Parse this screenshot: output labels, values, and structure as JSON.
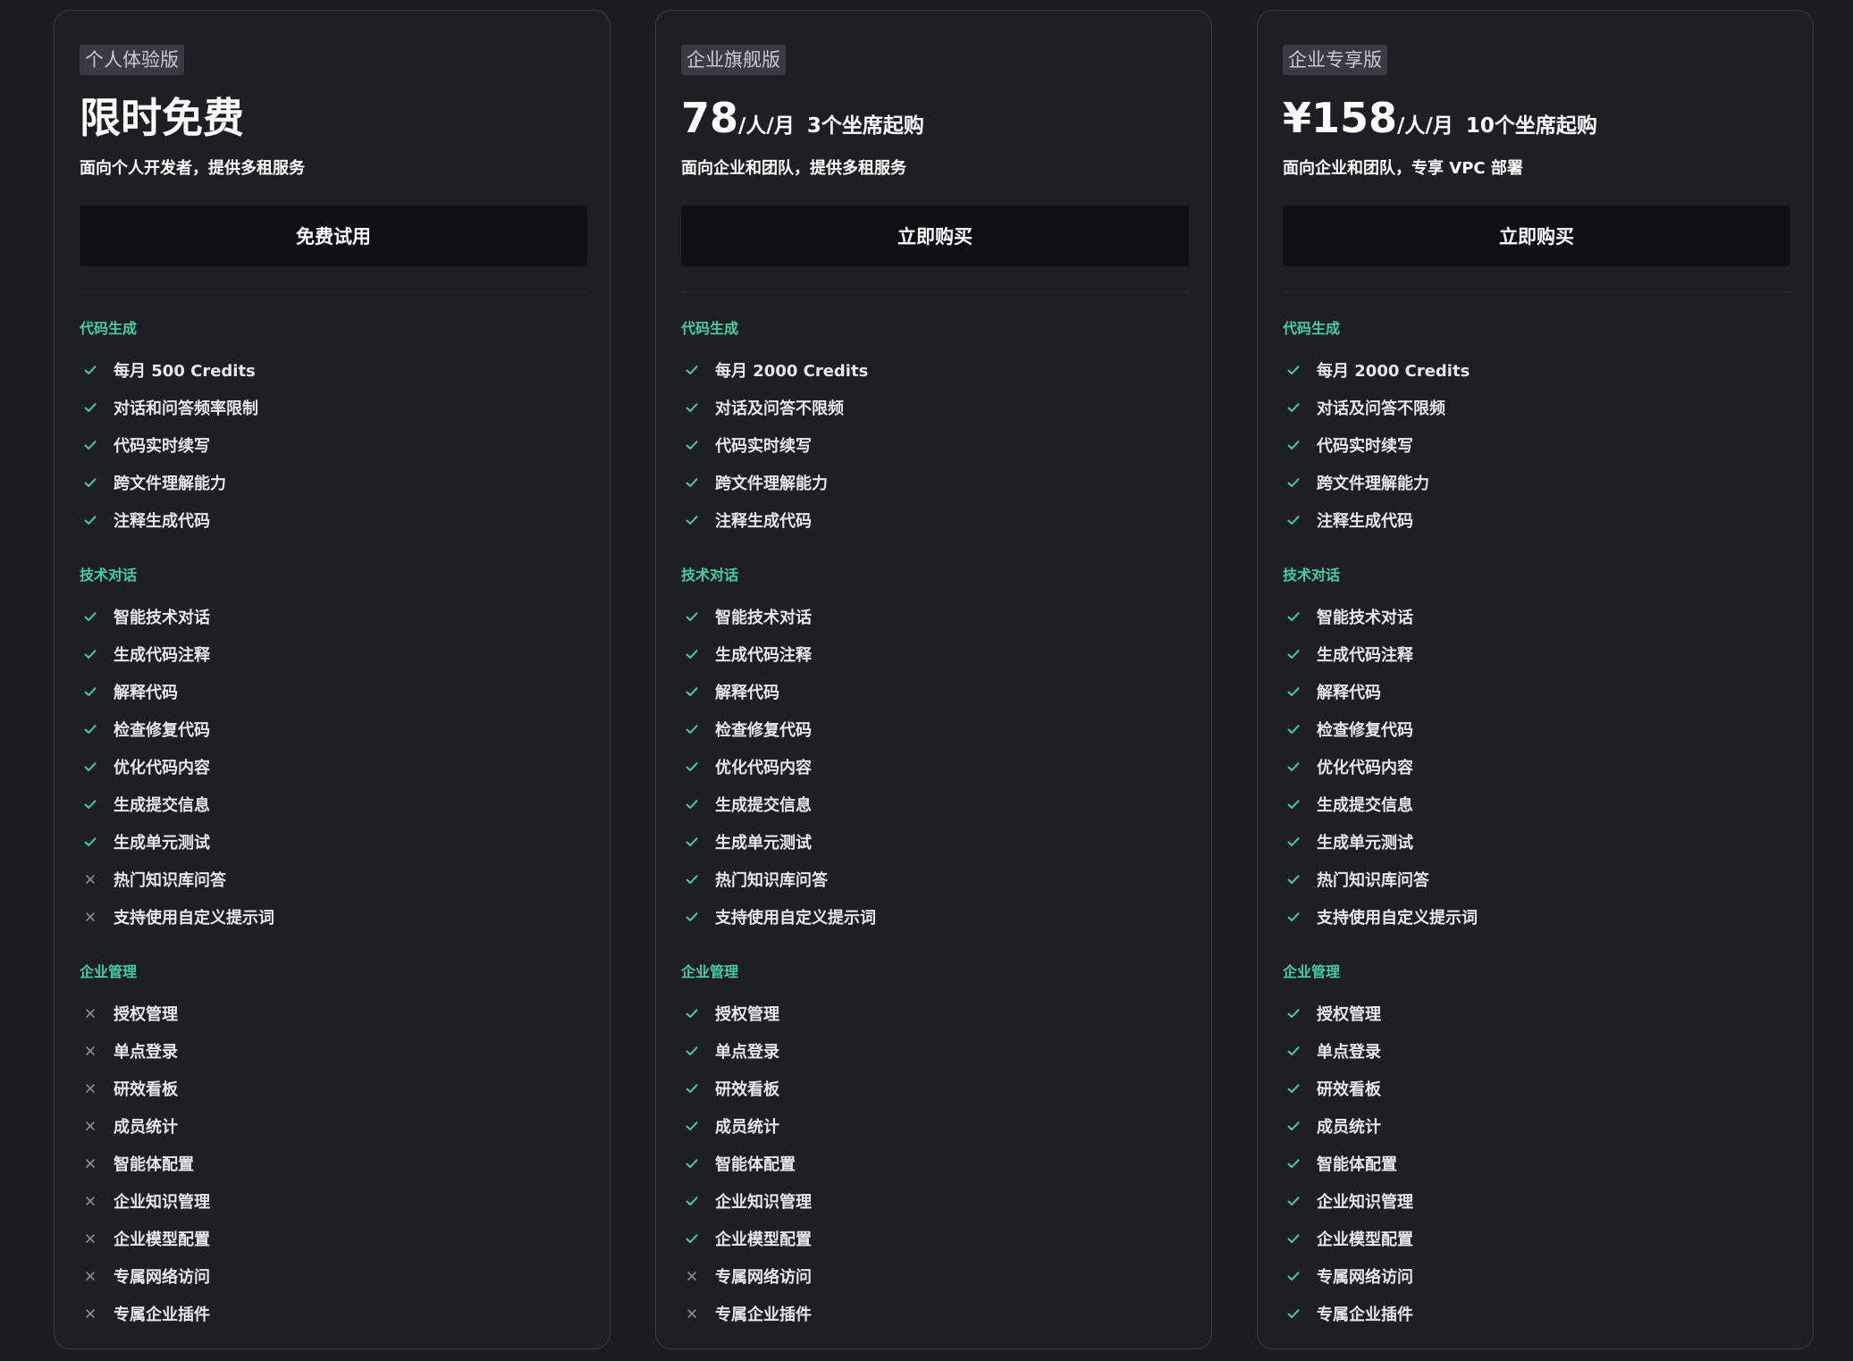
{
  "colors": {
    "background": "#1c1c22",
    "card": "#1e1e25",
    "card_border": "#3a3a44",
    "accent_green": "#3fd1a0",
    "cross_gray": "#8a8a96",
    "button_bg": "#0f0f14"
  },
  "plans": [
    {
      "badge": "个人体验版",
      "price": "限时免费",
      "unit": "",
      "note": "",
      "description": "面向个人开发者，提供多租服务",
      "cta": "免费试用",
      "sections": [
        {
          "title": "代码生成",
          "items": [
            {
              "label": "每月 500 Credits",
              "included": true
            },
            {
              "label": "对话和问答频率限制",
              "included": true
            },
            {
              "label": "代码实时续写",
              "included": true
            },
            {
              "label": "跨文件理解能力",
              "included": true
            },
            {
              "label": "注释生成代码",
              "included": true
            }
          ]
        },
        {
          "title": "技术对话",
          "items": [
            {
              "label": "智能技术对话",
              "included": true
            },
            {
              "label": "生成代码注释",
              "included": true
            },
            {
              "label": "解释代码",
              "included": true
            },
            {
              "label": "检查修复代码",
              "included": true
            },
            {
              "label": "优化代码内容",
              "included": true
            },
            {
              "label": "生成提交信息",
              "included": true
            },
            {
              "label": "生成单元测试",
              "included": true
            },
            {
              "label": "热门知识库问答",
              "included": false
            },
            {
              "label": "支持使用自定义提示词",
              "included": false
            }
          ]
        },
        {
          "title": "企业管理",
          "items": [
            {
              "label": "授权管理",
              "included": false
            },
            {
              "label": "单点登录",
              "included": false
            },
            {
              "label": "研效看板",
              "included": false
            },
            {
              "label": "成员统计",
              "included": false
            },
            {
              "label": "智能体配置",
              "included": false
            },
            {
              "label": "企业知识管理",
              "included": false
            },
            {
              "label": "企业模型配置",
              "included": false
            },
            {
              "label": "专属网络访问",
              "included": false
            },
            {
              "label": "专属企业插件",
              "included": false
            }
          ]
        }
      ]
    },
    {
      "badge": "企业旗舰版",
      "price": "78",
      "unit": "/人/月",
      "note": "3个坐席起购",
      "description": "面向企业和团队，提供多租服务",
      "cta": "立即购买",
      "sections": [
        {
          "title": "代码生成",
          "items": [
            {
              "label": "每月 2000 Credits",
              "included": true
            },
            {
              "label": "对话及问答不限频",
              "included": true
            },
            {
              "label": "代码实时续写",
              "included": true
            },
            {
              "label": "跨文件理解能力",
              "included": true
            },
            {
              "label": "注释生成代码",
              "included": true
            }
          ]
        },
        {
          "title": "技术对话",
          "items": [
            {
              "label": "智能技术对话",
              "included": true
            },
            {
              "label": "生成代码注释",
              "included": true
            },
            {
              "label": "解释代码",
              "included": true
            },
            {
              "label": "检查修复代码",
              "included": true
            },
            {
              "label": "优化代码内容",
              "included": true
            },
            {
              "label": "生成提交信息",
              "included": true
            },
            {
              "label": "生成单元测试",
              "included": true
            },
            {
              "label": "热门知识库问答",
              "included": true
            },
            {
              "label": "支持使用自定义提示词",
              "included": true
            }
          ]
        },
        {
          "title": "企业管理",
          "items": [
            {
              "label": "授权管理",
              "included": true
            },
            {
              "label": "单点登录",
              "included": true
            },
            {
              "label": "研效看板",
              "included": true
            },
            {
              "label": "成员统计",
              "included": true
            },
            {
              "label": "智能体配置",
              "included": true
            },
            {
              "label": "企业知识管理",
              "included": true
            },
            {
              "label": "企业模型配置",
              "included": true
            },
            {
              "label": "专属网络访问",
              "included": false
            },
            {
              "label": "专属企业插件",
              "included": false
            }
          ]
        }
      ]
    },
    {
      "badge": "企业专享版",
      "price": "¥158",
      "unit": "/人/月",
      "note": "10个坐席起购",
      "description": "面向企业和团队，专享 VPC 部署",
      "cta": "立即购买",
      "sections": [
        {
          "title": "代码生成",
          "items": [
            {
              "label": "每月 2000 Credits",
              "included": true
            },
            {
              "label": "对话及问答不限频",
              "included": true
            },
            {
              "label": "代码实时续写",
              "included": true
            },
            {
              "label": "跨文件理解能力",
              "included": true
            },
            {
              "label": "注释生成代码",
              "included": true
            }
          ]
        },
        {
          "title": "技术对话",
          "items": [
            {
              "label": "智能技术对话",
              "included": true
            },
            {
              "label": "生成代码注释",
              "included": true
            },
            {
              "label": "解释代码",
              "included": true
            },
            {
              "label": "检查修复代码",
              "included": true
            },
            {
              "label": "优化代码内容",
              "included": true
            },
            {
              "label": "生成提交信息",
              "included": true
            },
            {
              "label": "生成单元测试",
              "included": true
            },
            {
              "label": "热门知识库问答",
              "included": true
            },
            {
              "label": "支持使用自定义提示词",
              "included": true
            }
          ]
        },
        {
          "title": "企业管理",
          "items": [
            {
              "label": "授权管理",
              "included": true
            },
            {
              "label": "单点登录",
              "included": true
            },
            {
              "label": "研效看板",
              "included": true
            },
            {
              "label": "成员统计",
              "included": true
            },
            {
              "label": "智能体配置",
              "included": true
            },
            {
              "label": "企业知识管理",
              "included": true
            },
            {
              "label": "企业模型配置",
              "included": true
            },
            {
              "label": "专属网络访问",
              "included": true
            },
            {
              "label": "专属企业插件",
              "included": true
            }
          ]
        }
      ]
    }
  ]
}
